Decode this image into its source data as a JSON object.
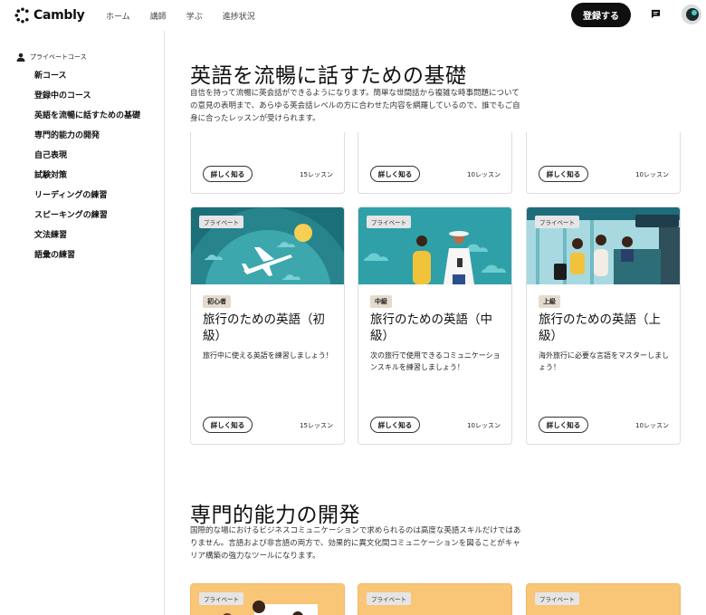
{
  "header": {
    "brand": "Cambly",
    "nav": [
      "ホーム",
      "講師",
      "学ぶ",
      "進捗状況"
    ],
    "signup_label": "登録する"
  },
  "sidebar": {
    "heading": "プライベートコース",
    "items": [
      "新コース",
      "登録中のコース",
      "英語を流暢に話すための基礎",
      "専門的能力の開発",
      "自己表現",
      "試験対策",
      "リーディングの練習",
      "スピーキングの練習",
      "文法練習",
      "語彙の練習"
    ]
  },
  "sections": [
    {
      "title": "英語を流暢に話すための基礎",
      "description": "自信を持って流暢に英会話ができるようになります。簡単な世間話から複雑な時事問題についての意見の表明まで、あらゆる英会話レベルの方に合わせた内容を網羅しているので、誰でもご自身に合ったレッスンが受けられます。",
      "top_row": [
        {
          "button": "詳しく知る",
          "lessons": "15レッスン"
        },
        {
          "button": "詳しく知る",
          "lessons": "10レッスン"
        },
        {
          "button": "詳しく知る",
          "lessons": "10レッスン"
        }
      ],
      "cards": [
        {
          "tag": "プライベート",
          "level": "初心者",
          "title": "旅行のための英語（初級）",
          "desc": "旅行中に使える英語を練習しましょう！",
          "button": "詳しく知る",
          "lessons": "15レッスン"
        },
        {
          "tag": "プライベート",
          "level": "中級",
          "title": "旅行のための英語（中級）",
          "desc": "次の旅行で使用できるコミュニケーションスキルを練習しましょう！",
          "button": "詳しく知る",
          "lessons": "10レッスン"
        },
        {
          "tag": "プライベート",
          "level": "上級",
          "title": "旅行のための英語（上級）",
          "desc": "海外旅行に必要な言語をマスターしましょう！",
          "button": "詳しく知る",
          "lessons": "10レッスン"
        }
      ]
    },
    {
      "title": "専門的能力の開発",
      "description": "国際的な場におけるビジネスコミュニケーションで求められるのは高度な英語スキルだけではありません。言語および非言語の両方で、効果的に異文化間コミュニケーションを図ることがキャリア構築の強力なツールになります。",
      "cards": [
        {
          "tag": "プライベート"
        },
        {
          "tag": "プライベート"
        },
        {
          "tag": "プライベート"
        }
      ]
    }
  ],
  "colors": {
    "teal_dark": "#1b6f78",
    "teal": "#2fa0a7",
    "orange": "#f9c577",
    "level_tag": "#e4dbcd"
  }
}
